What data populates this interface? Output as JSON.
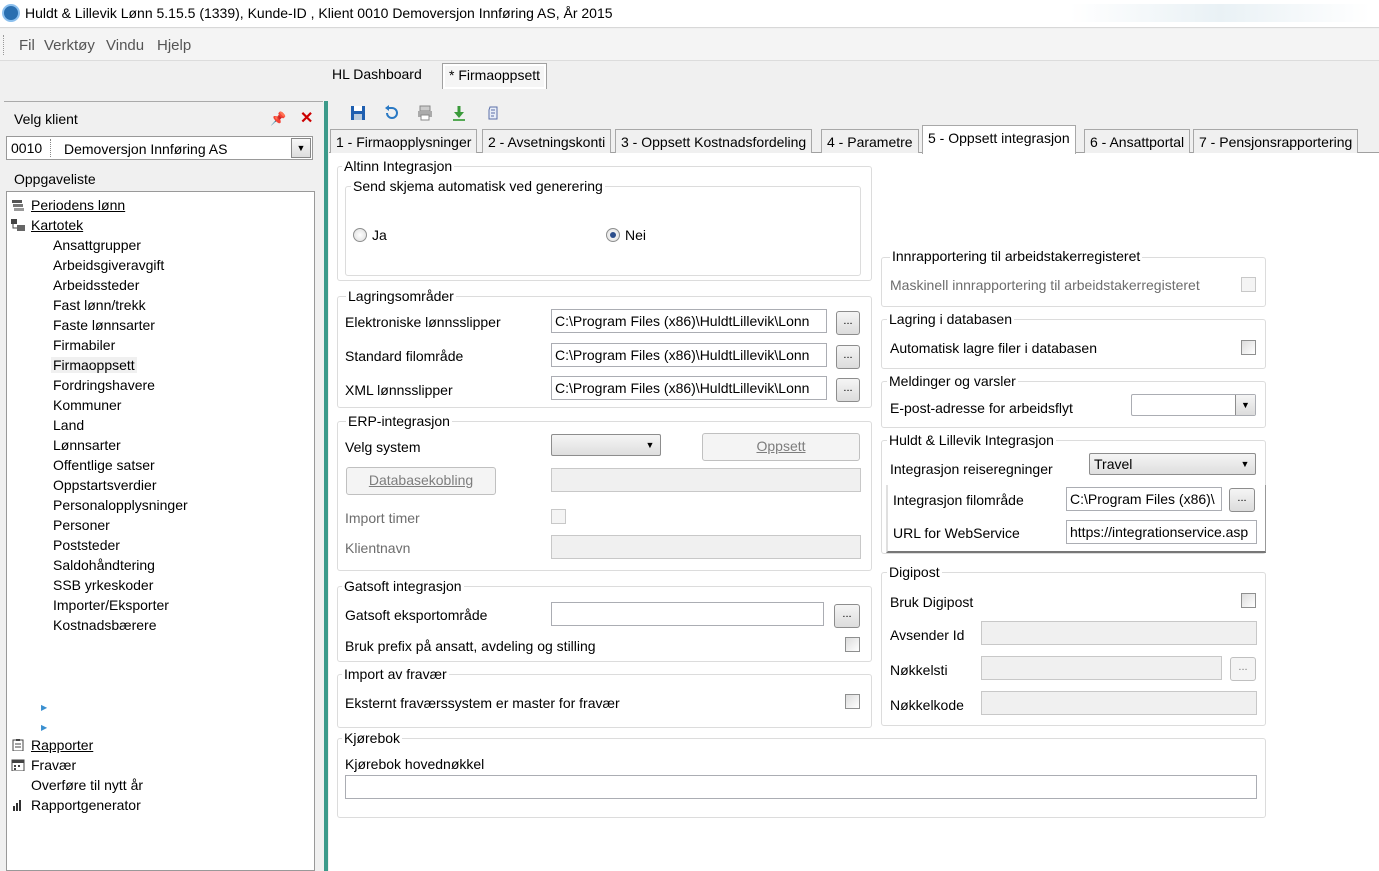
{
  "window": {
    "title": "Huldt & Lillevik Lønn 5.15.5 (1339), Kunde-ID , Klient 0010 Demoversjon Innføring AS, År 2015"
  },
  "menu": {
    "fil": "Fil",
    "verktoy": "Verktøy",
    "vindu": "Vindu",
    "hjelp": "Hjelp"
  },
  "doc_tabs": {
    "dashboard": "HL Dashboard",
    "firmaoppsett": "* Firmaoppsett"
  },
  "left": {
    "header": "Velg klient",
    "client_code": "0010",
    "client_name": "Demoversjon Innføring AS",
    "oppgaveliste": "Oppgaveliste",
    "tree": {
      "periodens_lonn": "Periodens lønn",
      "kartotek": "Kartotek",
      "children": [
        "Ansattgrupper",
        "Arbeidsgiveravgift",
        "Arbeidssteder",
        "Fast lønn/trekk",
        "Faste lønnsarter",
        "Firmabiler",
        "Firmaoppsett",
        "Fordringshavere",
        "Kommuner",
        "Land",
        "Lønnsarter",
        "Offentlige satser",
        "Oppstartsverdier",
        "Personalopplysninger",
        "Personer",
        "Poststeder",
        "Saldohåndtering",
        "SSB yrkeskoder",
        "Importer/Eksporter",
        "Kostnadsbærere"
      ],
      "rapporter": "Rapporter",
      "fravaer": "Fravær",
      "overfore": "Overføre til nytt år",
      "rapportgenerator": "Rapportgenerator"
    }
  },
  "tabs": [
    "1 - Firmaopplysninger",
    "2 - Avsetningskonti",
    "3 - Oppsett Kostnadsfordeling",
    "4 - Parametre",
    "5 - Oppsett integrasjon",
    "6 - Ansattportal",
    "7 - Pensjonsrapportering"
  ],
  "altinn": {
    "title": "Altinn Integrasjon",
    "sub_title": "Send skjema automatisk ved generering",
    "ja": "Ja",
    "nei": "Nei",
    "selected": "Nei"
  },
  "lagring": {
    "title": "Lagringsområder",
    "elektroniske_label": "Elektroniske lønnsslipper",
    "elektroniske_value": "C:\\Program Files (x86)\\HuldtLillevik\\Lonn",
    "standard_label": "Standard filområde",
    "standard_value": "C:\\Program Files (x86)\\HuldtLillevik\\Lonn",
    "xml_label": "XML lønnsslipper",
    "xml_value": "C:\\Program Files (x86)\\HuldtLillevik\\Lonn",
    "browse": "..."
  },
  "erp": {
    "title": "ERP-integrasjon",
    "velg_system": "Velg system",
    "oppsett": "Oppsett",
    "databasekobling": "Databasekobling",
    "import_timer": "Import timer",
    "klientnavn": "Klientnavn"
  },
  "gatsoft": {
    "title": "Gatsoft integrasjon",
    "eksport_label": "Gatsoft eksportområde",
    "prefix_label": "Bruk prefix på ansatt, avdeling og stilling"
  },
  "fravaer": {
    "title": "Import av fravær",
    "label": "Eksternt fraværssystem er master for fravær"
  },
  "kjorebok": {
    "title": "Kjørebok",
    "label": "Kjørebok hovednøkkel"
  },
  "aa": {
    "title": "Innrapportering til arbeidstakerregisteret",
    "label": "Maskinell innrapportering til arbeidstakerregisteret"
  },
  "lagring_db": {
    "title": "Lagring i databasen",
    "label": "Automatisk lagre filer i databasen"
  },
  "meldinger": {
    "title": "Meldinger og varsler",
    "label": "E-post-adresse for arbeidsflyt"
  },
  "hl_integrasjon": {
    "title": "Huldt & Lillevik Integrasjon",
    "reise_label": "Integrasjon reiseregninger",
    "reise_value": "Travel",
    "filomrade_label": "Integrasjon filområde",
    "filomrade_value": "C:\\Program Files (x86)\\",
    "url_label": "URL for WebService",
    "url_value": "https://integrationservice.asp"
  },
  "digipost": {
    "title": "Digipost",
    "bruk": "Bruk Digipost",
    "avsender": "Avsender Id",
    "nokkelsti": "Nøkkelsti",
    "nokkelkode": "Nøkkelkode"
  },
  "colors": {
    "splitter": "#3c9a8a",
    "toolbar_save": "#1f5fb0"
  }
}
